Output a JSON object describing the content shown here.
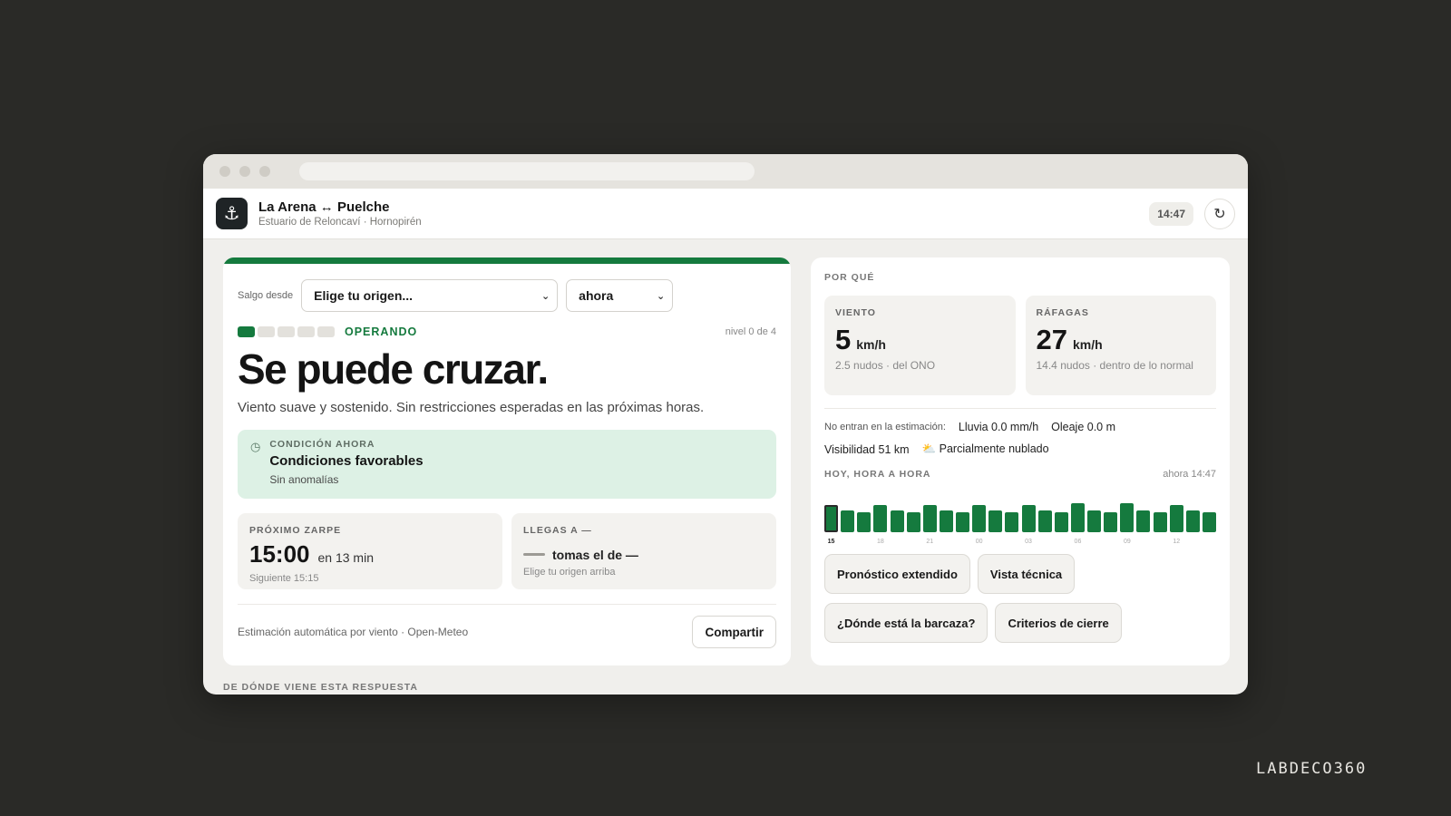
{
  "header": {
    "title": "La Arena ↔ Puelche",
    "subtitle": "Estuario de Reloncaví · Hornopirén",
    "logo_icon": "anchor-icon",
    "clock": "14:47",
    "refresh_icon": "refresh-icon"
  },
  "origin": {
    "label": "Salgo desde",
    "selected": "Elige tu origen...",
    "time_selected": "ahora"
  },
  "status": {
    "level_value": 1,
    "level_total": 5,
    "label": "OPERANDO",
    "level_text": "nivel 0 de 4",
    "headline": "Se puede cruzar.",
    "description": "Viento suave y sostenido. Sin restricciones esperadas en las próximas horas."
  },
  "condition": {
    "kicker": "CONDICIÓN AHORA",
    "title": "Condiciones favorables",
    "subtitle": "Sin anomalías"
  },
  "departure": {
    "kicker": "PRÓXIMO ZARPE",
    "time": "15:00",
    "in": "en 13 min",
    "next": "Siguiente 15:15"
  },
  "arrival": {
    "kicker": "LLEGAS A —",
    "text": "tomas el de —",
    "hint": "Elige tu origen arriba"
  },
  "footer": {
    "source": "Estimación automática por viento · Open-Meteo",
    "share_label": "Compartir"
  },
  "why": {
    "kicker": "POR QUÉ",
    "wind": {
      "kicker": "VIENTO",
      "value": "5",
      "unit": "km/h",
      "sub": "2.5 nudos · del ONO"
    },
    "gusts": {
      "kicker": "RÁFAGAS",
      "value": "27",
      "unit": "km/h",
      "sub": "14.4 nudos · dentro de lo normal"
    },
    "excluded_label": "No entran en la estimación:",
    "rain": "Lluvia 0.0 mm/h",
    "swell": "Oleaje 0.0 m",
    "visibility": "Visibilidad 51 km",
    "sky": "Parcialmente nublado",
    "sky_icon": "partly-cloudy-icon"
  },
  "hourly": {
    "kicker": "HOY, HORA A HORA",
    "now": "ahora 14:47",
    "current_index": 0,
    "levels": [
      0.95,
      0.75,
      0.7,
      0.95,
      0.75,
      0.7,
      0.95,
      0.75,
      0.7,
      0.95,
      0.75,
      0.7,
      0.95,
      0.75,
      0.7,
      1.0,
      0.75,
      0.7,
      1.0,
      0.75,
      0.7,
      0.95,
      0.75,
      0.7
    ],
    "tick_labels": [
      "15",
      "18",
      "21",
      "00",
      "03",
      "06",
      "09",
      "12"
    ]
  },
  "actions": {
    "extended": "Pronóstico extendido",
    "technical": "Vista técnica",
    "where": "¿Dónde está la barcaza?",
    "criteria": "Criterios de cierre"
  },
  "bottom_kicker": "DE DÓNDE VIENE ESTA RESPUESTA",
  "watermark": "LABDECO360",
  "colors": {
    "accent": "#157a3e",
    "favorable_bg": "#ddf1e5",
    "page_bg": "#2a2a27"
  }
}
